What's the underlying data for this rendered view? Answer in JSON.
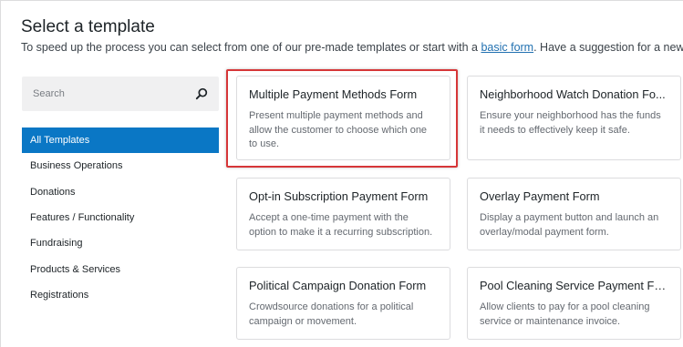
{
  "header": {
    "title": "Select a template",
    "subtitle_before": "To speed up the process you can select from one of our pre-made templates or start with a ",
    "subtitle_link": "basic form",
    "subtitle_after": ". Have a suggestion for a new template"
  },
  "search": {
    "placeholder": "Search",
    "icon": "search-icon"
  },
  "categories": [
    {
      "label": "All Templates",
      "active": true
    },
    {
      "label": "Business Operations"
    },
    {
      "label": "Donations"
    },
    {
      "label": "Features / Functionality"
    },
    {
      "label": "Fundraising"
    },
    {
      "label": "Products & Services"
    },
    {
      "label": "Registrations"
    }
  ],
  "templates": [
    {
      "title": "Multiple Payment Methods Form",
      "description": "Present multiple payment methods and allow the customer to choose which one to use.",
      "highlighted": true
    },
    {
      "title": "Neighborhood Watch Donation Fo...",
      "description": "Ensure your neighborhood has the funds it needs to effectively keep it safe."
    },
    {
      "title": "Opt-in Subscription Payment Form",
      "description": "Accept a one-time payment with the option to make it a recurring subscription."
    },
    {
      "title": "Overlay Payment Form",
      "description": "Display a payment button and launch an overlay/modal payment form."
    },
    {
      "title": "Political Campaign Donation Form",
      "description": "Crowdsource donations for a political campaign or movement."
    },
    {
      "title": "Pool Cleaning Service Payment Fo...",
      "description": "Allow clients to pay for a pool cleaning service or maintenance invoice."
    }
  ],
  "colors": {
    "accent": "#0a77c5",
    "link": "#2271b1",
    "highlight": "#d63638"
  }
}
